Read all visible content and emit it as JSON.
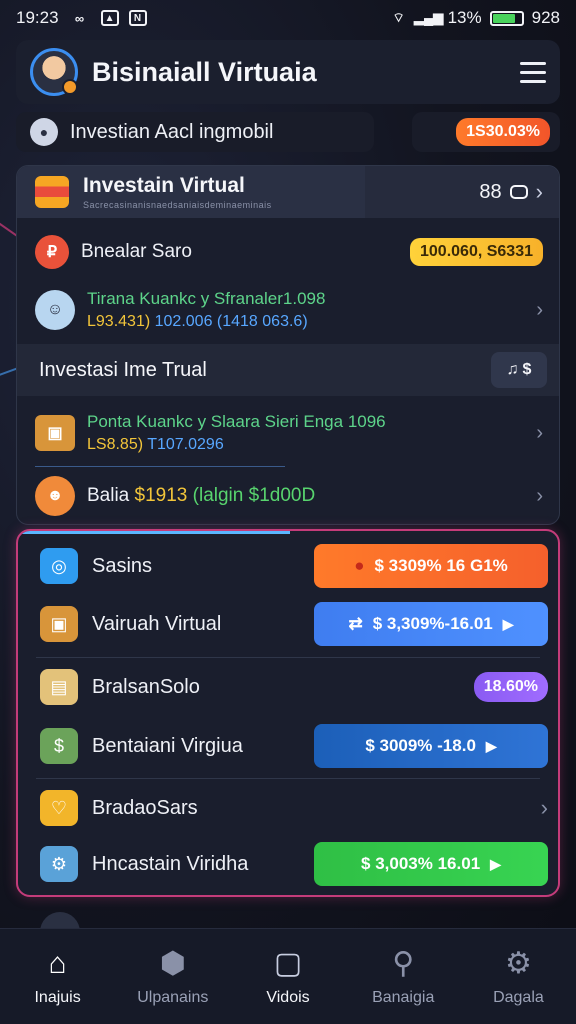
{
  "status_bar": {
    "time": "19:23",
    "battery_text": "13%",
    "right_time": "928",
    "battery_level": 0.8
  },
  "header": {
    "title": "Bisinaiall Virtuaia"
  },
  "subbar": {
    "text": "Investian Aacl ingmobil",
    "badge": "1S30.03%"
  },
  "card1": {
    "title": "Investain Virtual",
    "subtitle": "Sacrecasinanisnaedsaniaisdeminaeminais",
    "right_value": "88",
    "row1_label": "Bnealar Saro",
    "row1_badge": "100.060, S6331",
    "row2_line1": "Tirana Kuankc y Sfranaler1.098",
    "row2_line2_a": "L93.431)",
    "row2_line2_b": "102.006 (1418 063.6)",
    "section_title": "Investasi Ime Trual",
    "section_btn_icon": "bell-icon",
    "section_btn_text": "$",
    "row3_line1": "Ponta Kuankc y Slaara Sieri Enga 1096",
    "row3_line2_a": "LS8.85)",
    "row3_line2_b": "T107.0296",
    "row4_label_a": "Balia",
    "row4_label_b": "$1913",
    "row4_label_c": "(lalgin $1d00D"
  },
  "card2": {
    "items": [
      {
        "label": "Sasins",
        "value": "$ 3309% 16 G1%",
        "style": "orange",
        "icon": "stopwatch-icon"
      },
      {
        "label": "Vairuah Virtual",
        "value": "$ 3,309%-16.01",
        "style": "blue",
        "icon": "box-icon"
      },
      {
        "label": "BralsanSolo",
        "value": "18.60%",
        "style": "purple",
        "icon": "document-icon"
      },
      {
        "label": "Bentaiani Virgiua",
        "value": "$ 3009% -18.0",
        "style": "darkblue",
        "icon": "money-icon"
      },
      {
        "label": "BradaoSars",
        "value": "",
        "style": "chevron",
        "icon": "heart-box-icon"
      },
      {
        "label": "Hncastain Viridha",
        "value": "$ 3,003% 16.01",
        "style": "green",
        "icon": "robot-icon"
      }
    ]
  },
  "bottom_nav": {
    "items": [
      {
        "label": "Inajuis",
        "icon": "home-icon",
        "active": true
      },
      {
        "label": "Ulpanains",
        "icon": "cube-icon",
        "active": false
      },
      {
        "label": "Vidois",
        "icon": "video-icon",
        "active": false
      },
      {
        "label": "Banaigia",
        "icon": "search-icon",
        "active": false
      },
      {
        "label": "Dagala",
        "icon": "gear-icon",
        "active": false
      }
    ]
  },
  "colors": {
    "accent_orange": "#ff7a2a",
    "accent_blue": "#3f7df0",
    "accent_green": "#2fbf45",
    "accent_purple": "#8a5bf2",
    "card_border_pink": "#c43c7a"
  }
}
